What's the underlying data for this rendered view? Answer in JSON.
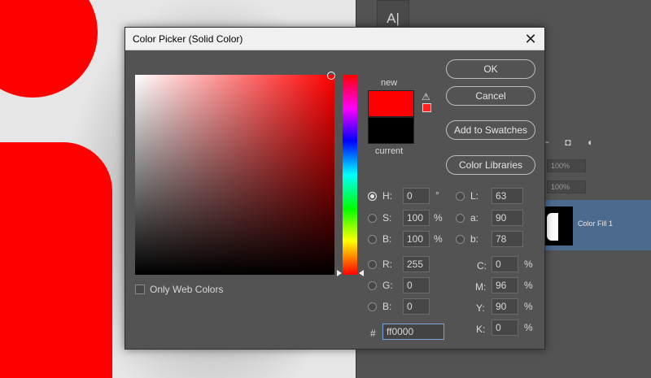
{
  "dialog": {
    "title": "Color Picker (Solid Color)",
    "close_glyph": "✕",
    "buttons": {
      "ok": "OK",
      "cancel": "Cancel",
      "add_to_swatches": "Add to Swatches",
      "color_libraries": "Color Libraries"
    },
    "swatch": {
      "new_label": "new",
      "current_label": "current",
      "new_color": "#ff0000",
      "current_color": "#000000"
    },
    "warning_glyph": "⚠",
    "only_web_colors": "Only Web Colors",
    "hsb": {
      "h": {
        "label": "H:",
        "value": "0",
        "unit": "°"
      },
      "s": {
        "label": "S:",
        "value": "100",
        "unit": "%"
      },
      "b": {
        "label": "B:",
        "value": "100",
        "unit": "%"
      }
    },
    "rgb": {
      "r": {
        "label": "R:",
        "value": "255"
      },
      "g": {
        "label": "G:",
        "value": "0"
      },
      "b": {
        "label": "B:",
        "value": "0"
      }
    },
    "lab": {
      "l": {
        "label": "L:",
        "value": "63"
      },
      "a": {
        "label": "a:",
        "value": "90"
      },
      "b": {
        "label": "b:",
        "value": "78"
      }
    },
    "cmyk": {
      "c": {
        "label": "C:",
        "value": "0",
        "unit": "%"
      },
      "m": {
        "label": "M:",
        "value": "96",
        "unit": "%"
      },
      "y": {
        "label": "Y:",
        "value": "90",
        "unit": "%"
      },
      "k": {
        "label": "K:",
        "value": "0",
        "unit": "%"
      }
    },
    "hex": {
      "label": "#",
      "value": "ff0000"
    },
    "selected_mode": "H"
  },
  "background": {
    "type_tool_glyph": "A|",
    "layers_icons": "⌐ ◘ ◖",
    "opacity_values": [
      "100%",
      "100%"
    ],
    "layer_name": "Color Fill 1",
    "colors": {
      "canvas_red": "#ff0000",
      "layer_selected": "#4c6a8e"
    }
  }
}
